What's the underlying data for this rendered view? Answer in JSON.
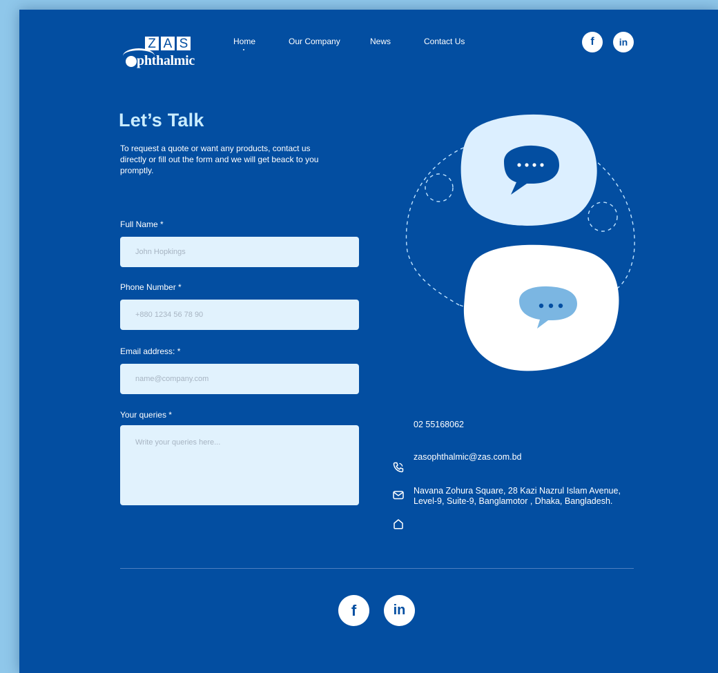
{
  "brand": {
    "letters": [
      "Z",
      "A",
      "S"
    ],
    "word": "phthalmic"
  },
  "nav": {
    "items": [
      {
        "label": "Home"
      },
      {
        "label": "Our Company"
      },
      {
        "label": "News"
      },
      {
        "label": "Contact Us"
      }
    ]
  },
  "social": {
    "facebook_glyph": "f",
    "linkedin_glyph": "in"
  },
  "hero": {
    "title": "Let’s Talk",
    "intro": "To request a quote or want any products, contact us directly or fill out the form and we will get beack to you promptly."
  },
  "form": {
    "full_name": {
      "label": "Full Name *",
      "placeholder": "John Hopkings"
    },
    "phone": {
      "label": "Phone Number *",
      "placeholder": "+880 1234 56 78 90"
    },
    "email": {
      "label": "Email address: *",
      "placeholder": "name@company.com"
    },
    "queries": {
      "label": "Your queries *",
      "placeholder": "Write your queries here..."
    }
  },
  "contact": {
    "phone": "02 55168062",
    "email": "zasophthalmic@zas.com.bd",
    "address": "Navana Zohura Square, 28 Kazi Nazrul Islam Avenue, Level-9, Suite-9, Banglamotor , Dhaka, Bangladesh."
  },
  "colors": {
    "page_bg": "#034ea1",
    "outer_bg": "#8fc7ea",
    "title": "#c9ecff",
    "field_bg": "#e1f2fd",
    "bubble_light": "#dcefff",
    "bubble_accent": "#7bb6e2"
  },
  "icons": [
    "facebook-icon",
    "linkedin-icon",
    "phone-icon",
    "mail-icon",
    "home-icon",
    "chat-bubble-icon"
  ]
}
